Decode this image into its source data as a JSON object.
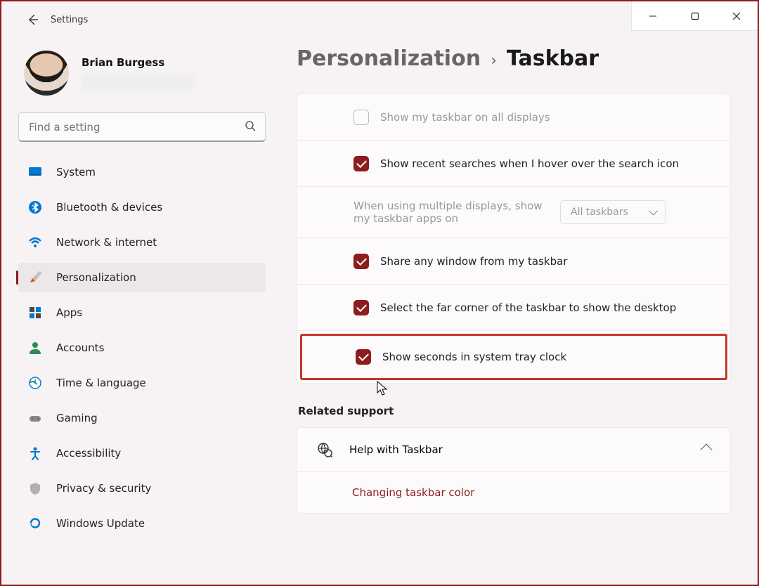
{
  "window": {
    "title": "Settings"
  },
  "profile": {
    "name": "Brian Burgess"
  },
  "search": {
    "placeholder": "Find a setting"
  },
  "sidebar": {
    "items": [
      {
        "label": "System"
      },
      {
        "label": "Bluetooth & devices"
      },
      {
        "label": "Network & internet"
      },
      {
        "label": "Personalization"
      },
      {
        "label": "Apps"
      },
      {
        "label": "Accounts"
      },
      {
        "label": "Time & language"
      },
      {
        "label": "Gaming"
      },
      {
        "label": "Accessibility"
      },
      {
        "label": "Privacy & security"
      },
      {
        "label": "Windows Update"
      }
    ]
  },
  "breadcrumb": {
    "parent": "Personalization",
    "current": "Taskbar"
  },
  "settings": {
    "show_all_displays": "Show my taskbar on all displays",
    "show_recent_searches": "Show recent searches when I hover over the search icon",
    "multi_display_label": "When using multiple displays, show my taskbar apps on",
    "multi_display_value": "All taskbars",
    "share_window": "Share any window from my taskbar",
    "far_corner": "Select the far corner of the taskbar to show the desktop",
    "show_seconds": "Show seconds in system tray clock"
  },
  "support": {
    "title": "Related support",
    "help": "Help with Taskbar",
    "link": "Changing taskbar color"
  }
}
